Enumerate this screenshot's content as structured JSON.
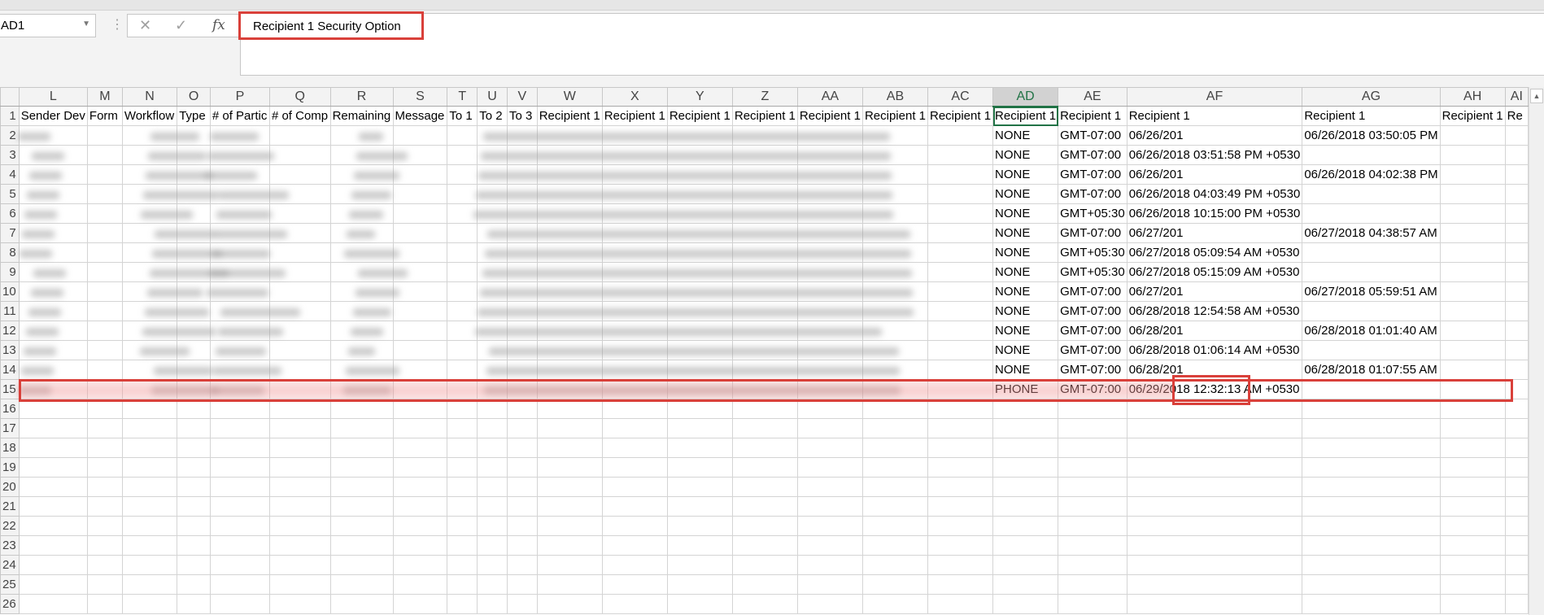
{
  "formula_bar": {
    "name_box": "AD1",
    "cancel_icon": "✕",
    "enter_icon": "✓",
    "fx_icon": "fx",
    "formula": "Recipient 1 Security Option"
  },
  "columns": [
    "L",
    "M",
    "N",
    "O",
    "P",
    "Q",
    "R",
    "S",
    "T",
    "U",
    "V",
    "W",
    "X",
    "Y",
    "Z",
    "AA",
    "AB",
    "AC",
    "AD",
    "AE",
    "AF",
    "AG",
    "AH",
    "AI"
  ],
  "selected_column": "AD",
  "header_row": [
    "Sender Dev",
    "Form",
    "Workflow",
    "Type",
    "# of Partic",
    "# of Comp",
    "Remaining",
    "Message",
    "To 1",
    "To 2",
    "To 3",
    "Recipient 1",
    "Recipient 1",
    "Recipient 1",
    "Recipient 1",
    "Recipient 1",
    "Recipient 1",
    "Recipient 1",
    "Recipient 1",
    "Recipient 1",
    "Recipient 1",
    "Recipient 1",
    "Recipient 1",
    "Re"
  ],
  "visible_rows": [
    {
      "ad": "NONE",
      "ae": "GMT-07:00",
      "af": "06/26/201",
      "ag": "06/26/2018 03:50:05 PM"
    },
    {
      "ad": "NONE",
      "ae": "GMT-07:00",
      "af": "06/26/2018 03:51:58 PM +0530",
      "ag": ""
    },
    {
      "ad": "NONE",
      "ae": "GMT-07:00",
      "af": "06/26/201",
      "ag": "06/26/2018 04:02:38 PM"
    },
    {
      "ad": "NONE",
      "ae": "GMT-07:00",
      "af": "06/26/2018 04:03:49 PM +0530",
      "ag": ""
    },
    {
      "ad": "NONE",
      "ae": "GMT+05:30",
      "af": "06/26/2018 10:15:00 PM +0530",
      "ag": ""
    },
    {
      "ad": "NONE",
      "ae": "GMT-07:00",
      "af": "06/27/201",
      "ag": "06/27/2018 04:38:57 AM"
    },
    {
      "ad": "NONE",
      "ae": "GMT+05:30",
      "af": "06/27/2018 05:09:54 AM +0530",
      "ag": ""
    },
    {
      "ad": "NONE",
      "ae": "GMT+05:30",
      "af": "06/27/2018 05:15:09 AM +0530",
      "ag": ""
    },
    {
      "ad": "NONE",
      "ae": "GMT-07:00",
      "af": "06/27/201",
      "ag": "06/27/2018 05:59:51 AM"
    },
    {
      "ad": "NONE",
      "ae": "GMT-07:00",
      "af": "06/28/2018 12:54:58 AM +0530",
      "ag": ""
    },
    {
      "ad": "NONE",
      "ae": "GMT-07:00",
      "af": "06/28/201",
      "ag": "06/28/2018 01:01:40 AM"
    },
    {
      "ad": "NONE",
      "ae": "GMT-07:00",
      "af": "06/28/2018 01:06:14 AM +0530",
      "ag": ""
    },
    {
      "ad": "NONE",
      "ae": "GMT-07:00",
      "af": "06/28/201",
      "ag": "06/28/2018 01:07:55 AM"
    },
    {
      "ad": "PHONE",
      "ae": "GMT-07:00",
      "af": "06/29/2018 12:32:13 AM +0530",
      "ag": ""
    }
  ],
  "row_count": 26,
  "left_stub_digits": {
    "2": "0",
    "4": "0",
    "7": "0",
    "8": "0",
    "9": "0"
  }
}
